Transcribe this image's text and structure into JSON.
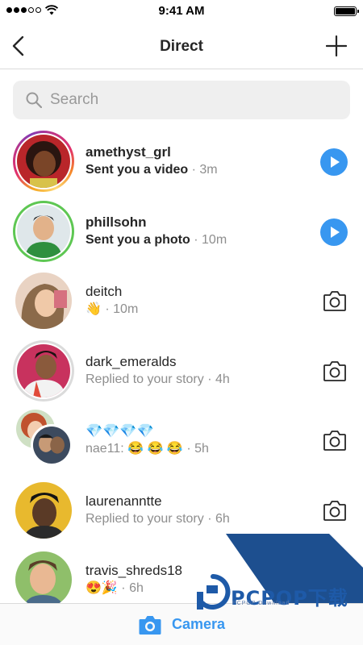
{
  "status_bar": {
    "time": "9:41 AM",
    "signal_bars": 5,
    "signal_filled": 3
  },
  "header": {
    "title": "Direct",
    "back_icon": "chevron-left-icon",
    "new_icon": "plus-icon"
  },
  "search": {
    "placeholder": "Search",
    "value": ""
  },
  "conversations": [
    {
      "name": "amethyst_grl",
      "message": "Sent you a video",
      "time": "3m",
      "unread": true,
      "ring": "story",
      "action": "play"
    },
    {
      "name": "phillsohn",
      "message": "Sent you a photo",
      "time": "10m",
      "unread": true,
      "ring": "close-friends",
      "action": "play"
    },
    {
      "name": "deitch",
      "message": "👋",
      "time": "10m",
      "unread": false,
      "ring": "none",
      "action": "camera"
    },
    {
      "name": "dark_emeralds",
      "message": "Replied to your story",
      "time": "4h",
      "unread": false,
      "ring": "seen",
      "action": "camera"
    },
    {
      "name": "💎💎💎💎",
      "message": "nae11: 😂 😂 😂",
      "time": "5h",
      "unread": false,
      "ring": "group",
      "action": "camera"
    },
    {
      "name": "laurenanntte",
      "message": "Replied to your story",
      "time": "6h",
      "unread": false,
      "ring": "none",
      "action": "camera"
    },
    {
      "name": "travis_shreds18",
      "message": "😍🎉",
      "time": "6h",
      "unread": false,
      "ring": "none",
      "action": "camera"
    }
  ],
  "time_separator": "·",
  "bottom_bar": {
    "label": "Camera",
    "icon": "camera-icon"
  },
  "watermark": {
    "title": "PCPOP下载",
    "subtitle": "PCPOP Download"
  },
  "colors": {
    "accent": "#3897f0",
    "text": "#262626",
    "muted": "#8e8e8e",
    "close_friends": "#5ec753"
  }
}
